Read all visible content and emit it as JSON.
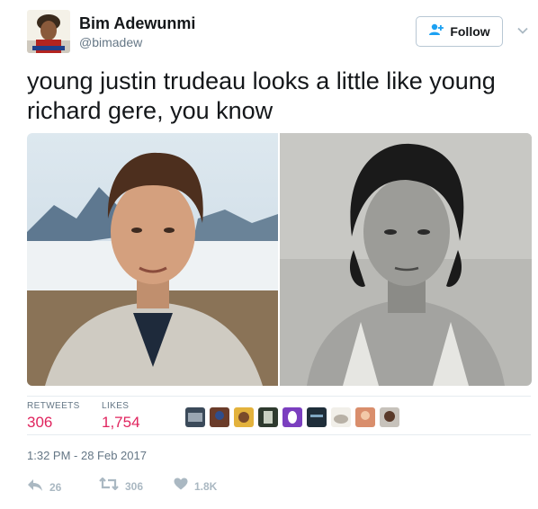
{
  "tweet": {
    "author_name": "Bim Adewunmi",
    "author_handle": "@bimadew",
    "text": "young justin trudeau looks a little like young richard gere, you know",
    "timestamp": "1:32 PM - 28 Feb 2017"
  },
  "follow_button": {
    "label": "Follow"
  },
  "stats": {
    "retweets_label": "RETWEETS",
    "retweets_value": "306",
    "likes_label": "LIKES",
    "likes_value": "1,754"
  },
  "actions": {
    "reply_count": "26",
    "retweet_count": "306",
    "like_count": "1.8K"
  },
  "icons": {
    "follow": "add-user-icon",
    "caret": "chevron-down-icon",
    "reply": "reply-icon",
    "retweet": "retweet-icon",
    "like": "heart-icon"
  },
  "colors": {
    "accent": "#1da1f2",
    "like_stat": "#e0245e",
    "muted": "#657786",
    "action_icon": "#aab8c2",
    "border": "#e6ecf0"
  }
}
